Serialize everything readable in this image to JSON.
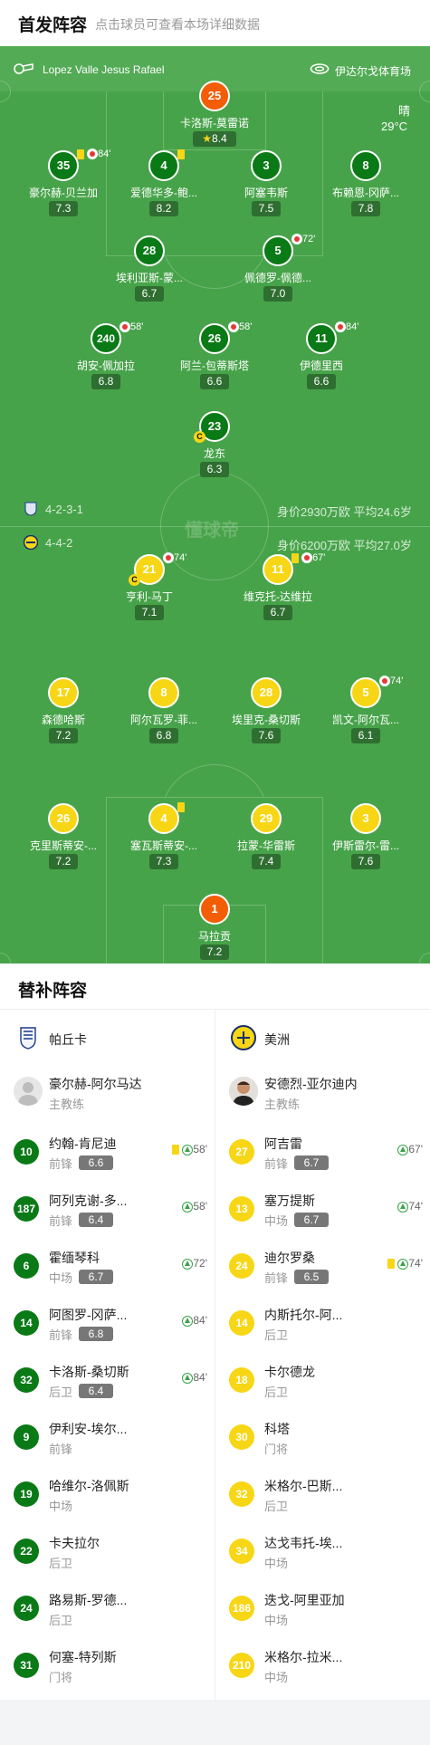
{
  "header": {
    "title": "首发阵容",
    "subtitle": "点击球员可查看本场详细数据"
  },
  "pitch": {
    "referee": "Lopez Valle Jesus Rafael",
    "stadium": "伊达尔戈体育场",
    "weather": "晴",
    "temperature": "29°C",
    "watermark": "懂球帝",
    "home": {
      "formation": "4-2-3-1",
      "value_text": "身价2930万欧 平均24.6岁"
    },
    "away": {
      "formation": "4-4-2",
      "value_text": "身价6200万欧 平均27.0岁"
    }
  },
  "home_players": [
    {
      "num": "25",
      "name": "卡洛斯-莫雷诺",
      "rating": "8.4",
      "star": true,
      "color": "o"
    },
    {
      "num": "35",
      "name": "豪尔赫-贝兰加",
      "rating": "7.3",
      "sub": "84'",
      "yellow": true
    },
    {
      "num": "4",
      "name": "爱德华多-鲍...",
      "rating": "8.2",
      "yellow": true
    },
    {
      "num": "3",
      "name": "阿塞韦斯",
      "rating": "7.5"
    },
    {
      "num": "8",
      "name": "布赖恩-冈萨...",
      "rating": "7.8"
    },
    {
      "num": "28",
      "name": "埃利亚斯-蒙...",
      "rating": "6.7"
    },
    {
      "num": "5",
      "name": "佩德罗-佩德...",
      "rating": "7.0",
      "sub": "72'"
    },
    {
      "num": "240",
      "name": "胡安-佩加拉",
      "rating": "6.8",
      "sub": "58'"
    },
    {
      "num": "26",
      "name": "阿兰-包蒂斯塔",
      "rating": "6.6",
      "sub": "58'"
    },
    {
      "num": "11",
      "name": "伊德里西",
      "rating": "6.6",
      "sub": "84'"
    },
    {
      "num": "23",
      "name": "龙东",
      "rating": "6.3",
      "captain": "C"
    }
  ],
  "away_players": [
    {
      "num": "21",
      "name": "亨利-马丁",
      "rating": "7.1",
      "sub": "74'",
      "captain": "C"
    },
    {
      "num": "11",
      "name": "维克托-达维拉",
      "rating": "6.7",
      "sub": "67'",
      "yellow": true
    },
    {
      "num": "17",
      "name": "森德哈斯",
      "rating": "7.2"
    },
    {
      "num": "8",
      "name": "阿尔瓦罗-菲...",
      "rating": "6.8"
    },
    {
      "num": "28",
      "name": "埃里克-桑切斯",
      "rating": "7.6"
    },
    {
      "num": "5",
      "name": "凯文-阿尔瓦...",
      "rating": "6.1",
      "sub": "74'"
    },
    {
      "num": "26",
      "name": "克里斯蒂安-...",
      "rating": "7.2"
    },
    {
      "num": "4",
      "name": "塞瓦斯蒂安-...",
      "rating": "7.3",
      "yellow": true
    },
    {
      "num": "29",
      "name": "拉蒙-华雷斯",
      "rating": "7.4"
    },
    {
      "num": "3",
      "name": "伊斯雷尔-雷...",
      "rating": "7.6"
    },
    {
      "num": "1",
      "name": "马拉贡",
      "rating": "7.2",
      "color": "o"
    }
  ],
  "subs_title": "替补阵容",
  "home_subs": {
    "team": "帕丘卡",
    "coach": {
      "name": "豪尔赫-阿尔马达",
      "role": "主教练"
    },
    "players": [
      {
        "num": "10",
        "name": "约翰-肯尼迪",
        "pos": "前锋",
        "rating": "6.6",
        "event": "58'",
        "yellow": true
      },
      {
        "num": "187",
        "name": "阿列克谢-多...",
        "pos": "前锋",
        "rating": "6.4",
        "event": "58'"
      },
      {
        "num": "6",
        "name": "霍缅琴科",
        "pos": "中场",
        "rating": "6.7",
        "event": "72'"
      },
      {
        "num": "14",
        "name": "阿图罗-冈萨...",
        "pos": "前锋",
        "rating": "6.8",
        "event": "84'"
      },
      {
        "num": "32",
        "name": "卡洛斯-桑切斯",
        "pos": "后卫",
        "rating": "6.4",
        "event": "84'"
      },
      {
        "num": "9",
        "name": "伊利安-埃尔...",
        "pos": "前锋"
      },
      {
        "num": "19",
        "name": "哈维尔-洛佩斯",
        "pos": "中场"
      },
      {
        "num": "22",
        "name": "卡夫拉尔",
        "pos": "后卫"
      },
      {
        "num": "24",
        "name": "路易斯-罗德...",
        "pos": "后卫"
      },
      {
        "num": "31",
        "name": "何塞-特列斯",
        "pos": "门将"
      }
    ]
  },
  "away_subs": {
    "team": "美洲",
    "coach": {
      "name": "安德烈-亚尔迪内",
      "role": "主教练"
    },
    "players": [
      {
        "num": "27",
        "name": "阿吉雷",
        "pos": "前锋",
        "rating": "6.7",
        "event": "67'"
      },
      {
        "num": "13",
        "name": "塞万提斯",
        "pos": "中场",
        "rating": "6.7",
        "event": "74'"
      },
      {
        "num": "24",
        "name": "迪尔罗桑",
        "pos": "前锋",
        "rating": "6.5",
        "event": "74'",
        "yellow": true
      },
      {
        "num": "14",
        "name": "内斯托尔-阿...",
        "pos": "后卫"
      },
      {
        "num": "18",
        "name": "卡尔德龙",
        "pos": "后卫"
      },
      {
        "num": "30",
        "name": "科塔",
        "pos": "门将"
      },
      {
        "num": "32",
        "name": "米格尔-巴斯...",
        "pos": "后卫"
      },
      {
        "num": "34",
        "name": "达戈韦托-埃...",
        "pos": "中场"
      },
      {
        "num": "186",
        "name": "迭戈-阿里亚加",
        "pos": "中场"
      },
      {
        "num": "210",
        "name": "米格尔-拉米...",
        "pos": "中场"
      }
    ]
  },
  "colors": {
    "pitch": "#47a34a",
    "home": "#0a7a16",
    "away": "#f7d615",
    "goalkeeper": "#f25d06"
  }
}
